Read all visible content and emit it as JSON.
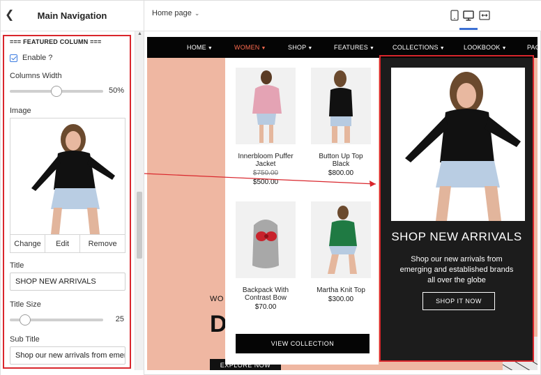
{
  "sidebar": {
    "title": "Main Navigation",
    "section_title": "=== FEATURED COLUMN ===",
    "enable_label": "Enable ?",
    "columns_width": {
      "label": "Columns Width",
      "value": "50%",
      "percent": 50
    },
    "image_label": "Image",
    "image_buttons": {
      "change": "Change",
      "edit": "Edit",
      "remove": "Remove"
    },
    "title_label": "Title",
    "title_value": "SHOP NEW ARRIVALS",
    "title_size": {
      "label": "Title Size",
      "value": "25",
      "percent": 12
    },
    "subtitle_label": "Sub Title",
    "subtitle_value": "Shop our new arrivals from emer"
  },
  "topbar": {
    "page_selector": "Home page",
    "devices": [
      "tablet-icon",
      "desktop-icon",
      "responsive-icon"
    ],
    "active_device": "desktop-icon"
  },
  "preview": {
    "nav": [
      "HOME",
      "WOMEN",
      "SHOP",
      "FEATURES",
      "COLLECTIONS",
      "LOOKBOOK",
      "PAG"
    ],
    "active_nav": "WOMEN",
    "hero_small": "WO",
    "hero_big": "D",
    "explore": "EXPLORE NOW",
    "products": [
      {
        "name": "Innerbloom Puffer Jacket",
        "old_price": "$750.00",
        "price": "$500.00"
      },
      {
        "name": "Button Up Top Black",
        "old_price": "",
        "price": "$800.00"
      },
      {
        "name": "Backpack With Contrast Bow",
        "old_price": "",
        "price": "$70.00"
      },
      {
        "name": "Martha Knit Top",
        "old_price": "",
        "price": "$300.00"
      }
    ],
    "view_collection": "VIEW COLLECTION",
    "featured": {
      "title": "SHOP NEW ARRIVALS",
      "subtitle": "Shop our new arrivals from emerging and established brands all over the globe",
      "button": "SHOP IT NOW"
    }
  },
  "colors": {
    "accent": "#3b6fd3",
    "highlight_border": "#d9262c",
    "nav_active": "#ff6b4f",
    "hero_bg": "#efb7a2"
  }
}
